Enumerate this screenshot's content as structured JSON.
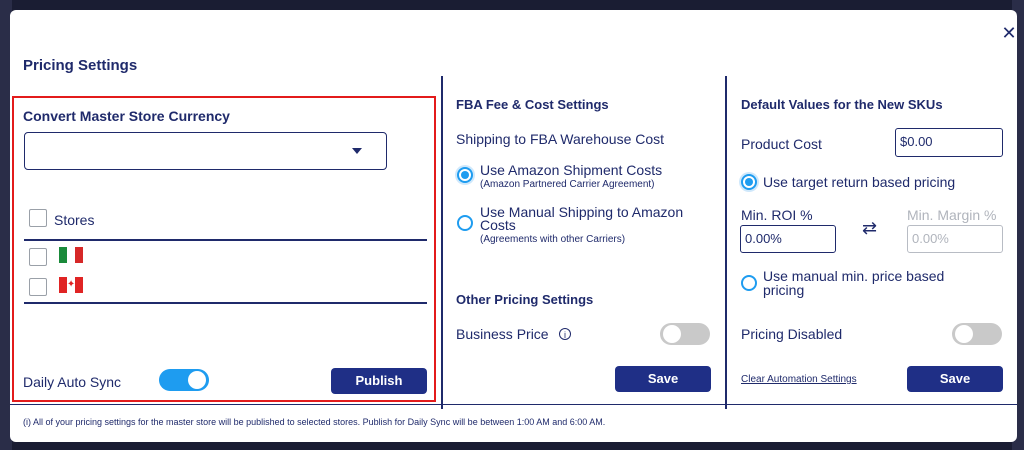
{
  "modal": {
    "title": "Pricing Settings",
    "close_glyph": "✕"
  },
  "currency": {
    "heading": "Convert Master Store Currency",
    "selected_value": "",
    "stores_label": "Stores",
    "stores": [
      {
        "flag": "mexico-flag-icon",
        "colors": [
          "#1a8a3a",
          "#ffffff",
          "#d62828"
        ]
      },
      {
        "flag": "canada-flag-icon",
        "colors": [
          "#e02424",
          "#ffffff",
          "#e02424"
        ]
      }
    ],
    "daily_sync_label": "Daily Auto Sync",
    "daily_sync_on": true,
    "publish_label": "Publish"
  },
  "fba": {
    "heading": "FBA Fee & Cost Settings",
    "shipping_heading": "Shipping to FBA Warehouse Cost",
    "option_amazon_label": "Use Amazon Shipment Costs",
    "option_amazon_sub": "(Amazon Partnered Carrier Agreement)",
    "option_manual_label_1": "Use Manual Shipping to Amazon",
    "option_manual_label_2": "Costs",
    "option_manual_sub": "(Agreements with other Carriers)",
    "selected": "amazon",
    "other_heading": "Other Pricing Settings",
    "business_price_label": "Business Price",
    "business_price_on": false,
    "save_label": "Save"
  },
  "defaults": {
    "heading": "Default Values for the New SKUs",
    "product_cost_label": "Product Cost",
    "product_cost_value": "$0.00",
    "option_target_label": "Use target return based pricing",
    "min_roi_label": "Min. ROI %",
    "min_roi_value": "0.00%",
    "min_margin_label": "Min. Margin %",
    "min_margin_placeholder": "0.00%",
    "option_manual_label_1": "Use manual min. price based",
    "option_manual_label_2": "pricing",
    "selected": "target",
    "pricing_disabled_label": "Pricing Disabled",
    "pricing_disabled_on": false,
    "clear_link": "Clear Automation Settings",
    "save_label": "Save"
  },
  "footnote": "(i) All of your pricing settings for the master store will be published to selected stores. Publish for Daily Sync will be between 1:00 AM and 6:00 AM."
}
